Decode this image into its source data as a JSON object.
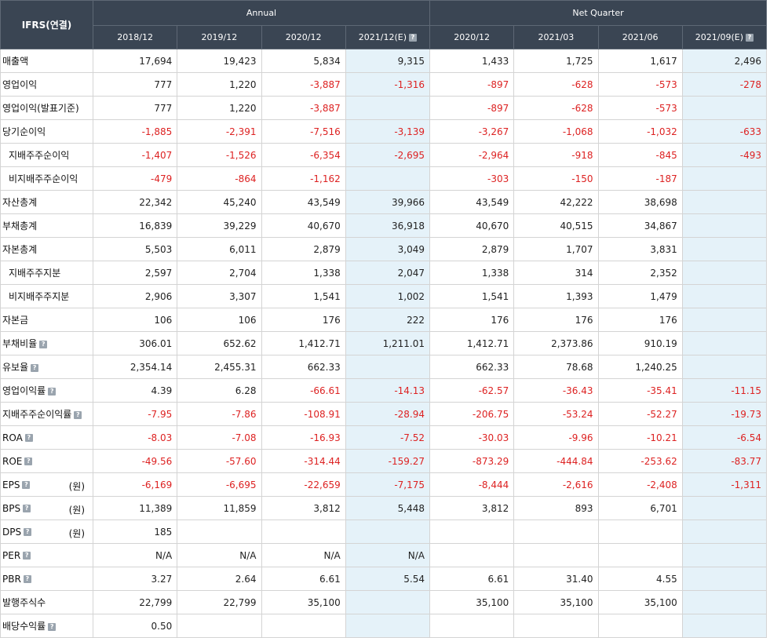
{
  "header": {
    "corner": "IFRS(연결)",
    "annual_label": "Annual",
    "quarter_label": "Net Quarter",
    "columns": [
      "2018/12",
      "2019/12",
      "2020/12",
      "2021/12(E)",
      "2020/12",
      "2021/03",
      "2021/06",
      "2021/09(E)"
    ]
  },
  "rows": [
    {
      "label": "매출액",
      "values": [
        "17,694",
        "19,423",
        "5,834",
        "9,315",
        "1,433",
        "1,725",
        "1,617",
        "2,496"
      ]
    },
    {
      "label": "영업이익",
      "values": [
        "777",
        "1,220",
        "-3,887",
        "-1,316",
        "-897",
        "-628",
        "-573",
        "-278"
      ]
    },
    {
      "label": "영업이익(발표기준)",
      "values": [
        "777",
        "1,220",
        "-3,887",
        "",
        "-897",
        "-628",
        "-573",
        ""
      ]
    },
    {
      "label": "당기순이익",
      "values": [
        "-1,885",
        "-2,391",
        "-7,516",
        "-3,139",
        "-3,267",
        "-1,068",
        "-1,032",
        "-633"
      ]
    },
    {
      "label": "지배주주순이익",
      "values": [
        "-1,407",
        "-1,526",
        "-6,354",
        "-2,695",
        "-2,964",
        "-918",
        "-845",
        "-493"
      ]
    },
    {
      "label": "비지배주주순이익",
      "values": [
        "-479",
        "-864",
        "-1,162",
        "",
        "-303",
        "-150",
        "-187",
        ""
      ]
    },
    {
      "label": "자산총계",
      "values": [
        "22,342",
        "45,240",
        "43,549",
        "39,966",
        "43,549",
        "42,222",
        "38,698",
        ""
      ]
    },
    {
      "label": "부채총계",
      "values": [
        "16,839",
        "39,229",
        "40,670",
        "36,918",
        "40,670",
        "40,515",
        "34,867",
        ""
      ]
    },
    {
      "label": "자본총계",
      "values": [
        "5,503",
        "6,011",
        "2,879",
        "3,049",
        "2,879",
        "1,707",
        "3,831",
        ""
      ]
    },
    {
      "label": "지배주주지분",
      "values": [
        "2,597",
        "2,704",
        "1,338",
        "2,047",
        "1,338",
        "314",
        "2,352",
        ""
      ]
    },
    {
      "label": "비지배주주지분",
      "values": [
        "2,906",
        "3,307",
        "1,541",
        "1,002",
        "1,541",
        "1,393",
        "1,479",
        ""
      ]
    },
    {
      "label": "자본금",
      "values": [
        "106",
        "106",
        "176",
        "222",
        "176",
        "176",
        "176",
        ""
      ]
    },
    {
      "label": "부채비율",
      "values": [
        "306.01",
        "652.62",
        "1,412.71",
        "1,211.01",
        "1,412.71",
        "2,373.86",
        "910.19",
        ""
      ]
    },
    {
      "label": "유보율",
      "values": [
        "2,354.14",
        "2,455.31",
        "662.33",
        "",
        "662.33",
        "78.68",
        "1,240.25",
        ""
      ]
    },
    {
      "label": "영업이익률",
      "values": [
        "4.39",
        "6.28",
        "-66.61",
        "-14.13",
        "-62.57",
        "-36.43",
        "-35.41",
        "-11.15"
      ]
    },
    {
      "label": "지배주주순이익률",
      "values": [
        "-7.95",
        "-7.86",
        "-108.91",
        "-28.94",
        "-206.75",
        "-53.24",
        "-52.27",
        "-19.73"
      ]
    },
    {
      "label": "ROA",
      "values": [
        "-8.03",
        "-7.08",
        "-16.93",
        "-7.52",
        "-30.03",
        "-9.96",
        "-10.21",
        "-6.54"
      ]
    },
    {
      "label": "ROE",
      "values": [
        "-49.56",
        "-57.60",
        "-314.44",
        "-159.27",
        "-873.29",
        "-444.84",
        "-253.62",
        "-83.77"
      ]
    },
    {
      "label": "EPS",
      "unit": "(원)",
      "values": [
        "-6,169",
        "-6,695",
        "-22,659",
        "-7,175",
        "-8,444",
        "-2,616",
        "-2,408",
        "-1,311"
      ]
    },
    {
      "label": "BPS",
      "unit": "(원)",
      "values": [
        "11,389",
        "11,859",
        "3,812",
        "5,448",
        "3,812",
        "893",
        "6,701",
        ""
      ]
    },
    {
      "label": "DPS",
      "unit": "(원)",
      "values": [
        "185",
        "",
        "",
        "",
        "",
        "",
        "",
        ""
      ]
    },
    {
      "label": "PER",
      "values": [
        "N/A",
        "N/A",
        "N/A",
        "N/A",
        "",
        "",
        "",
        ""
      ]
    },
    {
      "label": "PBR",
      "values": [
        "3.27",
        "2.64",
        "6.61",
        "5.54",
        "6.61",
        "31.40",
        "4.55",
        ""
      ]
    },
    {
      "label": "발행주식수",
      "values": [
        "22,799",
        "22,799",
        "35,100",
        "",
        "35,100",
        "35,100",
        "35,100",
        ""
      ]
    },
    {
      "label": "배당수익률",
      "values": [
        "0.50",
        "",
        "",
        "",
        "",
        "",
        "",
        ""
      ]
    }
  ],
  "icons": {
    "help": "question-mark-icon"
  },
  "colors": {
    "header_bg": "#3a4553",
    "estimate_bg": "#e5f2f9",
    "negative": "#dd2222"
  }
}
